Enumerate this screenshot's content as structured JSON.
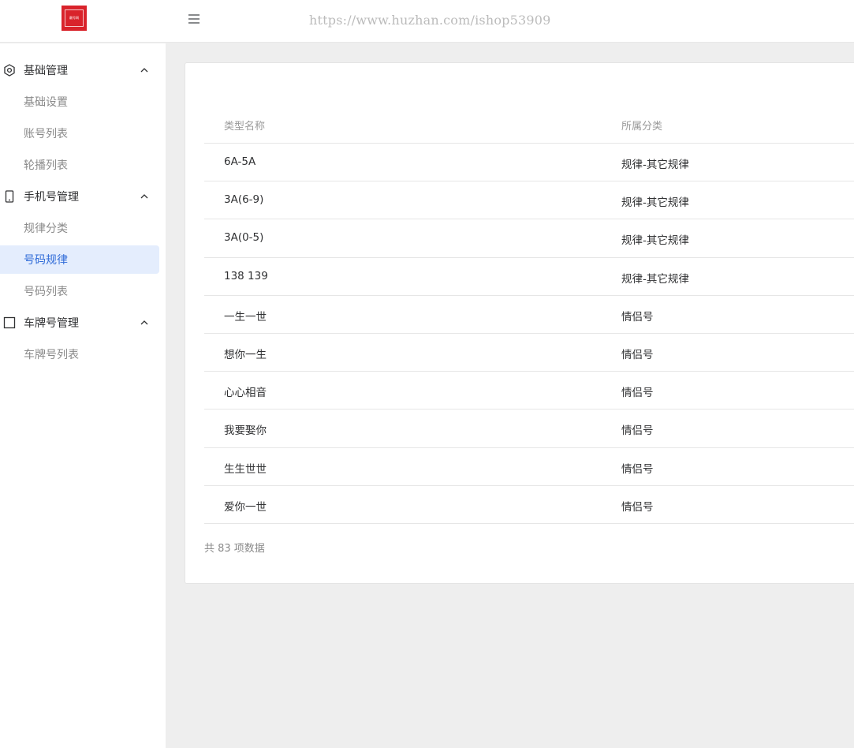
{
  "header": {
    "logo_text": "靓号网",
    "logo_color": "#d9232b",
    "menu_toggle_icon": "hamburger-icon",
    "watermark": "https://www.huzhan.com/ishop53909"
  },
  "sidebar": {
    "groups": [
      {
        "label": "基础管理",
        "icon": "settings-hexagon-icon",
        "items": [
          {
            "label": "基础设置"
          },
          {
            "label": "账号列表"
          },
          {
            "label": "轮播列表"
          }
        ]
      },
      {
        "label": "手机号管理",
        "icon": "mobile-phone-icon",
        "items": [
          {
            "label": "规律分类"
          },
          {
            "label": "号码规律",
            "active": true
          },
          {
            "label": "号码列表"
          }
        ]
      },
      {
        "label": "车牌号管理",
        "icon": "square-icon",
        "items": [
          {
            "label": "车牌号列表"
          }
        ]
      }
    ],
    "active_color": "#2f6bd8",
    "active_bg": "#e4edfd"
  },
  "table": {
    "columns": [
      "类型名称",
      "所属分类"
    ],
    "rows": [
      {
        "name": "6A-5A",
        "category": "规律-其它规律"
      },
      {
        "name": "3A(6-9)",
        "category": "规律-其它规律"
      },
      {
        "name": "3A(0-5)",
        "category": "规律-其它规律"
      },
      {
        "name": "138 139",
        "category": "规律-其它规律"
      },
      {
        "name": "一生一世",
        "category": "情侣号"
      },
      {
        "name": "想你一生",
        "category": "情侣号"
      },
      {
        "name": "心心相音",
        "category": "情侣号"
      },
      {
        "name": "我要娶你",
        "category": "情侣号"
      },
      {
        "name": "生生世世",
        "category": "情侣号"
      },
      {
        "name": "爱你一世",
        "category": "情侣号"
      }
    ],
    "total": "共 83 项数据"
  }
}
